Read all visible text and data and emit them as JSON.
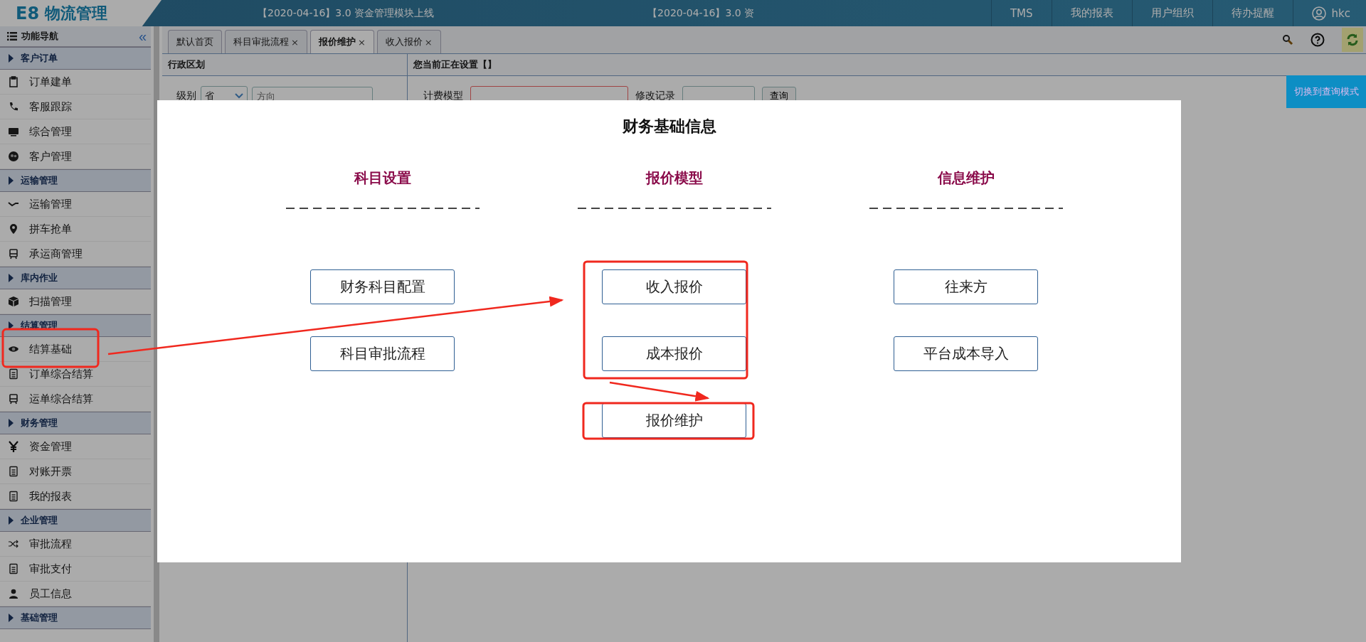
{
  "header": {
    "logo_mark": "E8",
    "logo_text": "物流管理",
    "notices": [
      "【2020-04-16】3.0 资金管理模块上线",
      "【2020-04-16】3.0 资"
    ],
    "nav": [
      {
        "label": "TMS"
      },
      {
        "label": "我的报表"
      },
      {
        "label": "用户组织"
      },
      {
        "label": "待办提醒"
      }
    ],
    "user": "hkc"
  },
  "sidebar": {
    "title": "功能导航",
    "collapse": "«",
    "groups": [
      {
        "label": "客户订单",
        "children": [
          {
            "label": "订单建单",
            "kind": "clipboard"
          },
          {
            "label": "客服跟踪",
            "kind": "phone"
          },
          {
            "label": "综合管理",
            "kind": "monitor"
          },
          {
            "label": "客户管理",
            "kind": "users"
          }
        ]
      },
      {
        "label": "运输管理",
        "children": [
          {
            "label": "运输管理",
            "kind": "route"
          },
          {
            "label": "拼车抢单",
            "kind": "pin"
          },
          {
            "label": "承运商管理",
            "kind": "bus"
          }
        ]
      },
      {
        "label": "库内作业",
        "children": [
          {
            "label": "扫描管理",
            "kind": "cube"
          }
        ]
      },
      {
        "label": "结算管理",
        "children": [
          {
            "label": "结算基础",
            "kind": "eye"
          },
          {
            "label": "订单综合结算",
            "kind": "doc"
          },
          {
            "label": "运单综合结算",
            "kind": "bus"
          }
        ]
      },
      {
        "label": "财务管理",
        "children": [
          {
            "label": "资金管理",
            "kind": "yen"
          },
          {
            "label": "对账开票",
            "kind": "doc"
          },
          {
            "label": "我的报表",
            "kind": "doc"
          }
        ]
      },
      {
        "label": "企业管理",
        "children": [
          {
            "label": "审批流程",
            "kind": "shuffle"
          },
          {
            "label": "审批支付",
            "kind": "doc"
          },
          {
            "label": "员工信息",
            "kind": "person"
          }
        ]
      },
      {
        "label": "基础管理"
      }
    ]
  },
  "tabs": [
    {
      "label": "默认首页",
      "selected": false
    },
    {
      "label": "科目审批流程",
      "close": "×",
      "selected": false
    },
    {
      "label": "报价维护",
      "close": "×",
      "selected": true
    },
    {
      "label": "收入报价",
      "close": "×",
      "selected": false
    }
  ],
  "left_panel": {
    "title": "行政区划",
    "level_label": "级别",
    "level_value": "省",
    "direction_placeholder": "方向"
  },
  "right_panel": {
    "title": "您当前正在设置【】",
    "model_label": "计费模型",
    "history_label": "修改记录",
    "query_button": "查询"
  },
  "switch_button": "切换到查询模式",
  "modal": {
    "title": "财务基础信息",
    "columns": [
      {
        "heading": "科目设置",
        "buttons": [
          "财务科目配置",
          "科目审批流程"
        ]
      },
      {
        "heading": "报价模型",
        "buttons": [
          "收入报价",
          "成本报价",
          "报价维护"
        ]
      },
      {
        "heading": "信息维护",
        "buttons": [
          "往来方",
          "平台成本导入"
        ]
      }
    ]
  }
}
